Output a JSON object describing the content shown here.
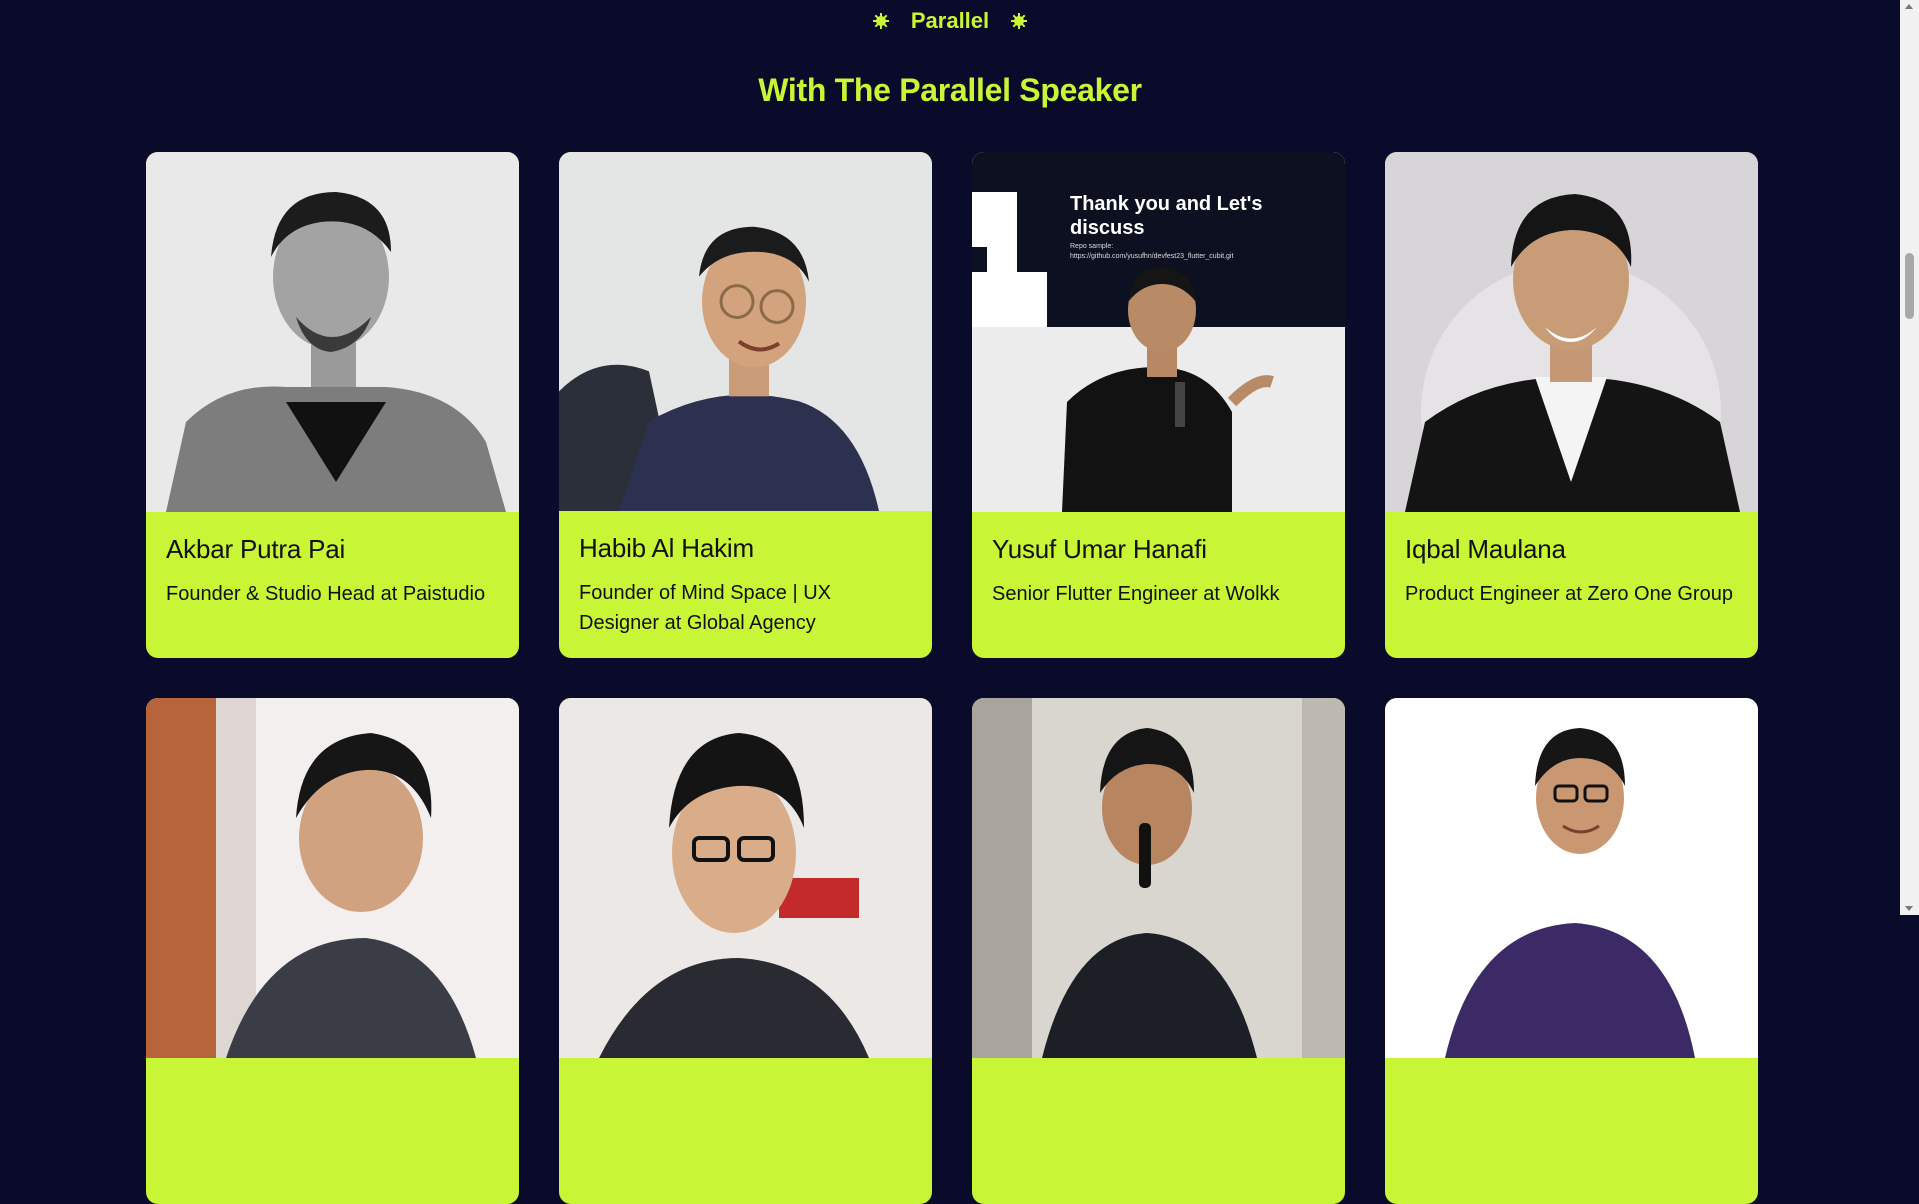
{
  "section": {
    "eyebrow": "Parallel",
    "heading": "With The Parallel Speaker"
  },
  "colors": {
    "background": "#0a0b2a",
    "accent": "#c8f535",
    "card_text": "#111111"
  },
  "speakers": [
    {
      "name": "Akbar Putra Pai",
      "role": "Founder & Studio Head at Paistudio",
      "photo_icon": "speaker-photo"
    },
    {
      "name": "Habib Al Hakim",
      "role": "Founder of Mind Space | UX Designer at Global Agency",
      "photo_icon": "speaker-photo"
    },
    {
      "name": "Yusuf Umar Hanafi",
      "role": "Senior Flutter Engineer at Wolkk",
      "photo_icon": "speaker-photo"
    },
    {
      "name": "Iqbal Maulana",
      "role": "Product Engineer at Zero One Group",
      "photo_icon": "speaker-photo"
    },
    {
      "name": "",
      "role": "",
      "photo_icon": "speaker-photo"
    },
    {
      "name": "",
      "role": "",
      "photo_icon": "speaker-photo"
    },
    {
      "name": "",
      "role": "",
      "photo_icon": "speaker-photo"
    },
    {
      "name": "",
      "role": "",
      "photo_icon": "speaker-photo"
    }
  ],
  "slide_photo_text": {
    "line1": "Thank you and Let's",
    "line2": "discuss",
    "line3": "Repo sample:",
    "line4": "https://github.com/yusufhn/devfest23_flutter_cubit.git"
  }
}
